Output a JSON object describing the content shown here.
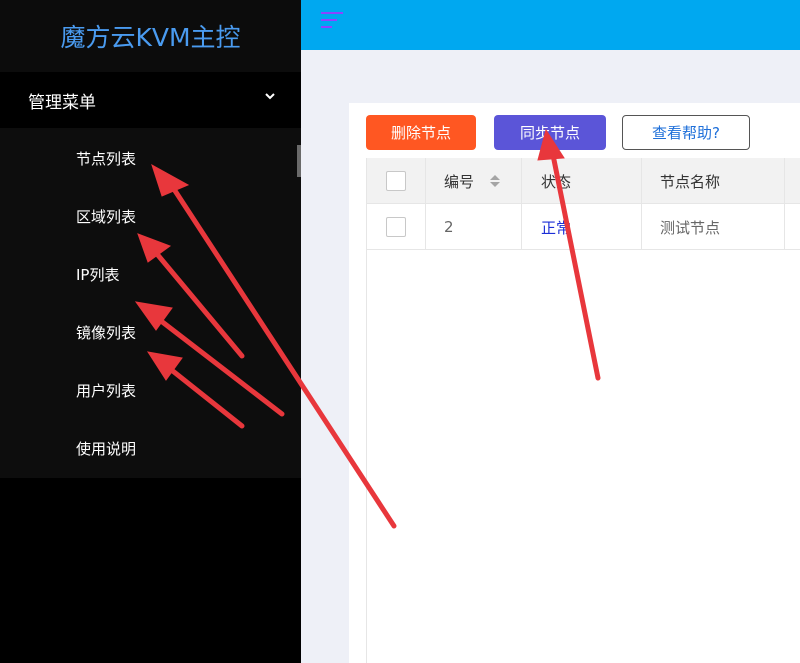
{
  "app": {
    "title": "魔方云KVM主控"
  },
  "sidebar": {
    "menu_header": "管理菜单",
    "items": [
      {
        "label": "节点列表"
      },
      {
        "label": "区域列表"
      },
      {
        "label": "IP列表"
      },
      {
        "label": "镜像列表"
      },
      {
        "label": "用户列表"
      },
      {
        "label": "使用说明"
      }
    ]
  },
  "toolbar": {
    "delete_label": "删除节点",
    "sync_label": "同步节点",
    "help_label": "查看帮助?"
  },
  "table": {
    "columns": [
      "编号",
      "状态",
      "节点名称"
    ],
    "rows": [
      {
        "id": "2",
        "status": "正常",
        "name": "测试节点"
      }
    ]
  },
  "colors": {
    "sidebar_bg": "#000000",
    "brand_text": "#4a9bf0",
    "topbar": "#00a8f0",
    "delete_button": "#ff5722",
    "sync_button": "#5b55d8",
    "help_text": "#1e6fd9",
    "status_text": "#1c2fd6",
    "annotation_arrow": "#e8373c"
  },
  "icons": [
    "menu-icon",
    "chevron-down-icon",
    "sort-icon",
    "checkbox-icon",
    "arrow-annotation"
  ]
}
